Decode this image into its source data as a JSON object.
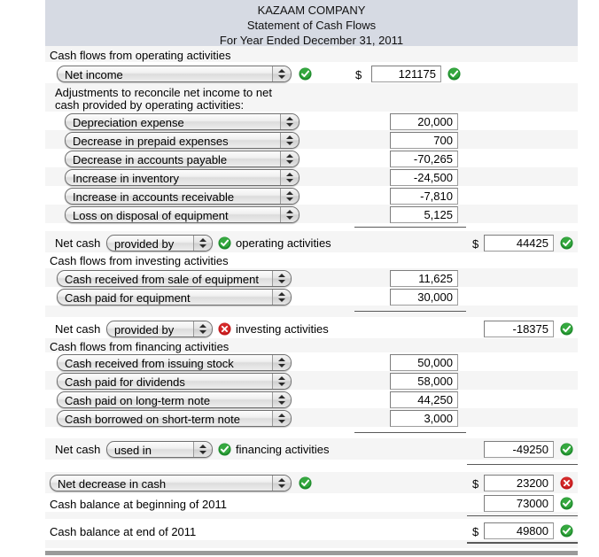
{
  "header": {
    "company": "KAZAAM COMPANY",
    "statement": "Statement of Cash Flows",
    "period": "For Year Ended December 31, 2011",
    "band_color": "#d6dae3"
  },
  "icons": {
    "correct": "check-circle-icon",
    "incorrect": "x-circle-icon",
    "correct_color": "#1d8a2b",
    "incorrect_color": "#c0171a"
  },
  "currency_symbol": "$",
  "sections": {
    "operating_heading": "Cash flows from operating activities",
    "adjustments_line1": "Adjustments to reconcile net income to net",
    "adjustments_line2": "cash provided by operating activities:",
    "investing_heading": "Cash flows from investing activities",
    "financing_heading": "Cash flows from financing activities"
  },
  "net_income_row": {
    "select_value": "Net income",
    "select_status": "correct",
    "amount": "121175",
    "amount_status": "correct",
    "has_dollar": true
  },
  "adjustments": [
    {
      "select_value": "Depreciation expense",
      "amount": "20,000"
    },
    {
      "select_value": "Decrease in prepaid expenses",
      "amount": "700"
    },
    {
      "select_value": "Decrease in accounts payable",
      "amount": "-70,265"
    },
    {
      "select_value": "Increase in inventory",
      "amount": "-24,500"
    },
    {
      "select_value": "Increase in accounts receivable",
      "amount": "-7,810"
    },
    {
      "select_value": "Loss on disposal of equipment",
      "amount": "5,125"
    }
  ],
  "net_operating": {
    "prefix": "Net cash",
    "select_value": "provided by",
    "select_status": "correct",
    "suffix": "operating activities",
    "amount": "44425",
    "amount_status": "correct",
    "has_dollar": true
  },
  "investing_items": [
    {
      "select_value": "Cash received from sale of equipment",
      "amount": "11,625"
    },
    {
      "select_value": "Cash paid for equipment",
      "amount": "30,000"
    }
  ],
  "net_investing": {
    "prefix": "Net cash",
    "select_value": "provided by",
    "select_status": "incorrect",
    "suffix": "investing activities",
    "amount": "-18375",
    "amount_status": "correct",
    "has_dollar": false
  },
  "financing_items": [
    {
      "select_value": "Cash received from issuing stock",
      "amount": "50,000"
    },
    {
      "select_value": "Cash paid for dividends",
      "amount": "58,000"
    },
    {
      "select_value": "Cash paid on long-term note",
      "amount": "44,250"
    },
    {
      "select_value": "Cash borrowed on short-term note",
      "amount": "3,000"
    }
  ],
  "net_financing": {
    "prefix": "Net cash",
    "select_value": "used in",
    "select_status": "correct",
    "suffix": "financing activities",
    "amount": "-49250",
    "amount_status": "correct",
    "has_dollar": false
  },
  "net_change": {
    "select_value": "Net decrease in cash",
    "select_status": "correct",
    "amount": "23200",
    "amount_status": "incorrect",
    "has_dollar": true
  },
  "beginning_balance": {
    "label": "Cash balance at beginning of 2011",
    "amount": "73000",
    "amount_status": "correct",
    "has_dollar": false
  },
  "ending_balance": {
    "label": "Cash balance at end of 2011",
    "amount": "49800",
    "amount_status": "correct",
    "has_dollar": true
  }
}
